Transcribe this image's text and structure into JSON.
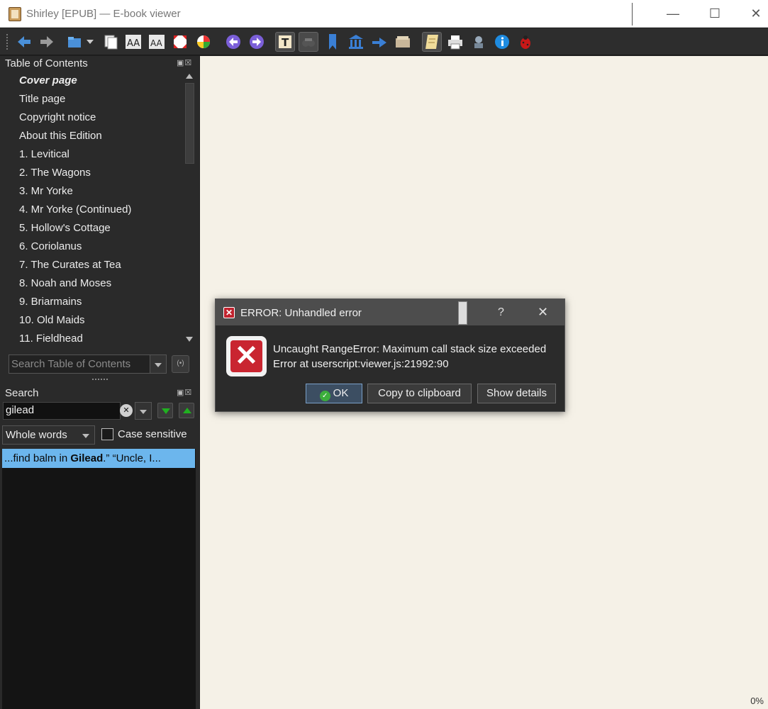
{
  "window": {
    "title": "Shirley [EPUB] — E-book viewer",
    "controls": {
      "minimize": "—",
      "maximize": "☐",
      "close": "✕"
    }
  },
  "toolbar": {
    "icons": [
      "toolbar-grip",
      "back-icon",
      "forward-icon",
      "open-icon",
      "open-dropdown-icon",
      "copy-icon",
      "font-size-larger-icon",
      "font-size-smaller-icon",
      "fullscreen-icon",
      "preferences-icon",
      "previous-page-icon",
      "next-page-icon",
      "toc-icon",
      "reference-mode-icon",
      "bookmark-icon",
      "library-icon",
      "lookup-icon",
      "metadata-icon",
      "inspector-icon",
      "print-icon",
      "settings-icon",
      "info-icon",
      "debug-icon"
    ]
  },
  "toc": {
    "header": "Table of Contents",
    "pane_controls": "▣☒",
    "items": [
      "Cover page",
      "Title page",
      "Copyright notice",
      "About this Edition",
      "1. Levitical",
      "2. The Wagons",
      "3. Mr Yorke",
      "4. Mr Yorke (Continued)",
      "5. Hollow's Cottage",
      "6. Coriolanus",
      "7. The Curates at Tea",
      "8. Noah and Moses",
      "9. Briarmains",
      "10. Old Maids",
      "11. Fieldhead"
    ],
    "search_placeholder": "Search Table of Contents",
    "go_label": "(•)"
  },
  "search": {
    "header": "Search",
    "pane_controls": "▣☒",
    "query": "gilead",
    "clear_label": "✕",
    "mode": "Whole words",
    "case_sensitive_label": "Case sensitive",
    "case_sensitive": false,
    "result_prefix": "...find balm in ",
    "result_match": "Gilead",
    "result_suffix": ".” “Uncle, I..."
  },
  "reader": {
    "progress": "0%"
  },
  "dialog": {
    "title_icon": "✕",
    "title": "ERROR: Unhandled error",
    "help": "?",
    "close": "✕",
    "error_icon": "✕",
    "message_line1": "Uncaught RangeError: Maximum call stack size exceeded",
    "message_line2": "Error at userscript:viewer.js:21992:90",
    "ok_label": "OK",
    "ok_check": "✓",
    "copy_label": "Copy to clipboard",
    "details_label": "Show details"
  },
  "colors": {
    "reader_background": "#f5f1e7",
    "selection": "#6cb6ed",
    "error_red": "#c92530",
    "panel_dark": "#2a2a2a"
  }
}
